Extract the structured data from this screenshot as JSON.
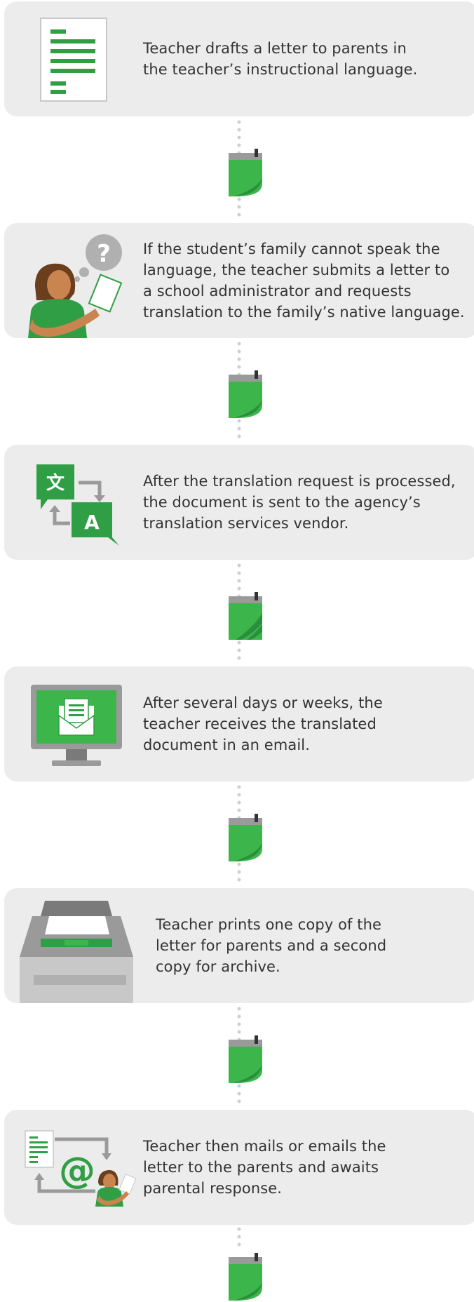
{
  "colors": {
    "card_bg": "#ebeceb",
    "green": "#2f9e44",
    "green_light": "#3cb54a",
    "gray": "#9a9a9a",
    "text": "#333333",
    "skin": "#c9844f",
    "hair": "#6b3e1e"
  },
  "steps": [
    {
      "text": "Teacher drafts a letter to parents in\nthe teacher’s instructional language.",
      "icon": "document-icon"
    },
    {
      "text": "If the student’s family cannot speak the\nlanguage, the teacher submits a letter to\na school administrator and requests\ntranslation to the family’s native language.",
      "icon": "teacher-question-icon"
    },
    {
      "text": "After the translation request is processed,\nthe document is sent to the agency’s\ntranslation services vendor.",
      "icon": "translate-icon"
    },
    {
      "text": "After several days or weeks, the\nteacher receives the translated\ndocument in an email.",
      "icon": "monitor-email-icon"
    },
    {
      "text": "Teacher prints one copy of the\nletter for parents and a second\ncopy for archive.",
      "icon": "printer-icon"
    },
    {
      "text": "Teacher then mails or emails the\nletter to the parents and awaits\nparental response.",
      "icon": "mail-email-icon"
    }
  ],
  "connector_icon": "calendar-page-icon"
}
